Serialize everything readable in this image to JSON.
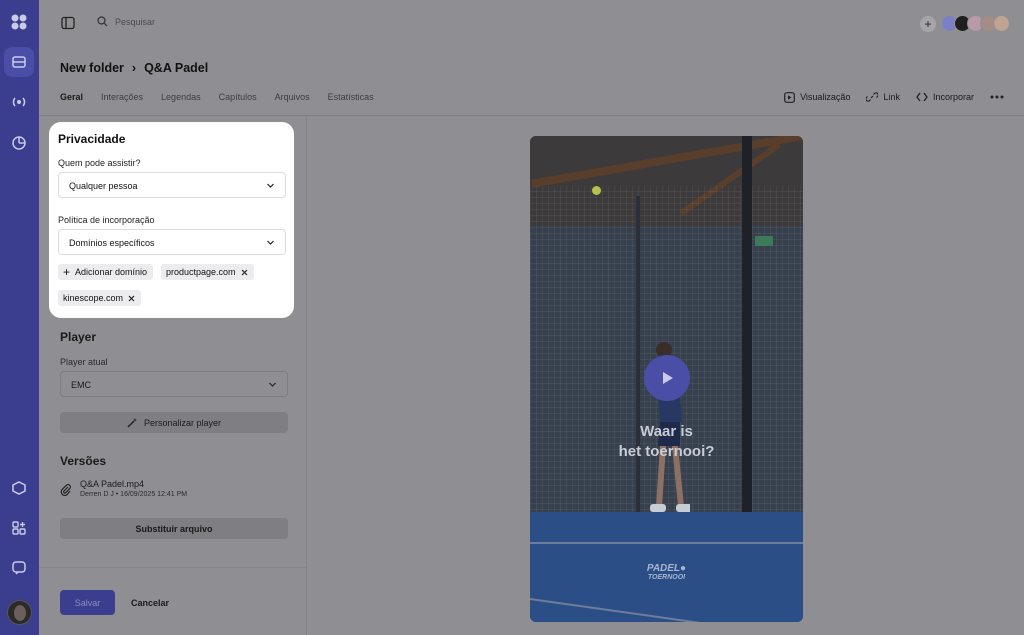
{
  "search": {
    "placeholder": "Pesquisar"
  },
  "breadcrumb": {
    "folder": "New folder",
    "separator": "›",
    "current": "Q&A Padel"
  },
  "tabs": [
    "Geral",
    "Interações",
    "Legendas",
    "Capítulos",
    "Arquivos",
    "Estatísticas"
  ],
  "active_tab": "Geral",
  "actions": {
    "preview": "Visualização",
    "link": "Link",
    "embed": "Incorporar"
  },
  "privacy": {
    "title": "Privacidade",
    "who_label": "Quem pode assistir?",
    "who_value": "Qualquer pessoa",
    "embed_label": "Política de incorporação",
    "embed_value": "Domínios específicos",
    "add_domain": "Adicionar domínio",
    "domains": [
      "productpage.com",
      "kinescope.com"
    ]
  },
  "player": {
    "title": "Player",
    "current_label": "Player atual",
    "current_value": "EMC",
    "customize": "Personalizar player"
  },
  "versions": {
    "title": "Versões",
    "file_name": "Q&A Padel.mp4",
    "file_meta": "Derren D J • 16/09/2025 12:41 PM",
    "replace": "Substituir arquivo"
  },
  "footer": {
    "save": "Salvar",
    "cancel": "Cancelar"
  },
  "video": {
    "caption_line1": "Waar is",
    "caption_line2": "het toernooi?",
    "logo_line1": "PADEL●",
    "logo_line2": "TOERNOOI"
  },
  "colors": {
    "accent": "#3b3d8f",
    "overlay": "#8f8f93",
    "card": "#ffffff"
  },
  "icons": [
    "app-logo-icon",
    "library-icon",
    "live-icon",
    "analytics-icon",
    "cube-icon",
    "apps-icon",
    "chat-icon",
    "sidebar-toggle-icon",
    "search-icon",
    "plus-icon",
    "chevron-down-icon",
    "close-icon",
    "play-icon",
    "link-icon",
    "code-icon",
    "more-icon",
    "paperclip-icon",
    "magic-icon"
  ]
}
